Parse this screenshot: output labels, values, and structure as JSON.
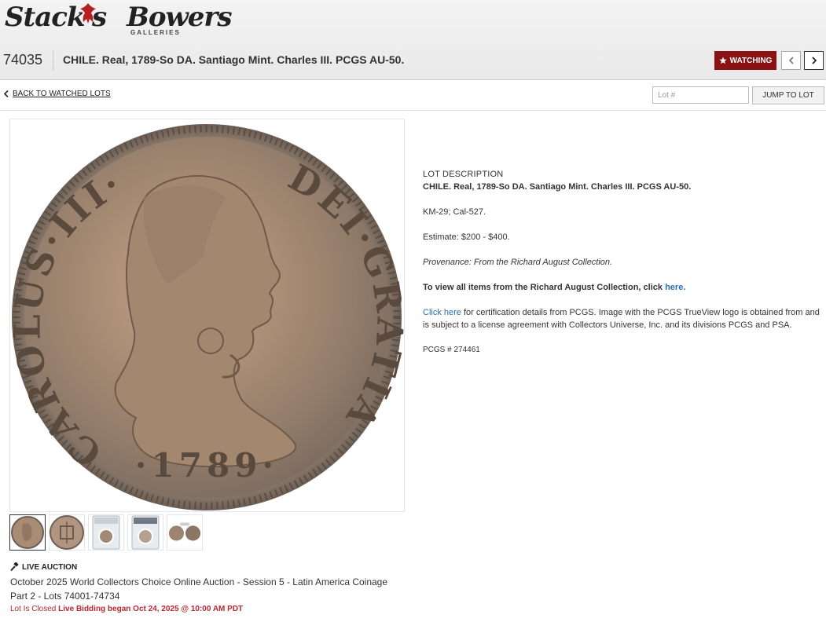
{
  "brand": {
    "name_left": "Stack's",
    "name_right": "Bowers",
    "sub": "GALLERIES"
  },
  "lot": {
    "number": "74035",
    "title": "CHILE. Real, 1789-So DA. Santiago Mint. Charles III. PCGS AU-50."
  },
  "toolbar": {
    "watch_label": "WATCHING",
    "prev_icon": "chevron-left-icon",
    "next_icon": "chevron-right-icon"
  },
  "subbar": {
    "back_label": "BACK TO WATCHED LOTS",
    "lot_placeholder": "Lot #",
    "jump_label": "JUMP TO LOT"
  },
  "coin": {
    "legend_left": "CAROLUS·III·",
    "legend_right": "DEI·GRATIA",
    "date": "·1789·"
  },
  "thumbnails": [
    {
      "name": "obverse"
    },
    {
      "name": "reverse"
    },
    {
      "name": "slab-front"
    },
    {
      "name": "slab-back"
    },
    {
      "name": "trueview"
    }
  ],
  "auction": {
    "type_label": "LIVE AUCTION",
    "name_line1": "October 2025 World Collectors Choice Online Auction - Session 5 - Latin America Coinage",
    "name_line2": "Part 2 - Lots 74001-74734",
    "closed_label": "Lot Is Closed",
    "bidding_label": "Live Bidding began Oct 24, 2025 @ 10:00 AM PDT"
  },
  "description": {
    "heading": "LOT DESCRIPTION",
    "title": "CHILE. Real, 1789-So DA. Santiago Mint. Charles III. PCGS AU-50.",
    "reference": "KM-29; Cal-527.",
    "estimate": "Estimate: $200 - $400.",
    "provenance": "Provenance: From the Richard August Collection.",
    "view_all": "To view all items from the Richard August Collection, click",
    "view_all_link": "here.",
    "cert_link": "Click here",
    "cert_text": "for certification details from PCGS. Image with the PCGS TrueView logo is obtained from and is subject to a license agreement with Collectors Universe, Inc. and its divisions PCGS and PSA.",
    "pcgs_label": "PCGS # 274461"
  },
  "colors": {
    "accent": "#8b1214",
    "link": "#2a6db0",
    "alert": "#b8282d"
  }
}
